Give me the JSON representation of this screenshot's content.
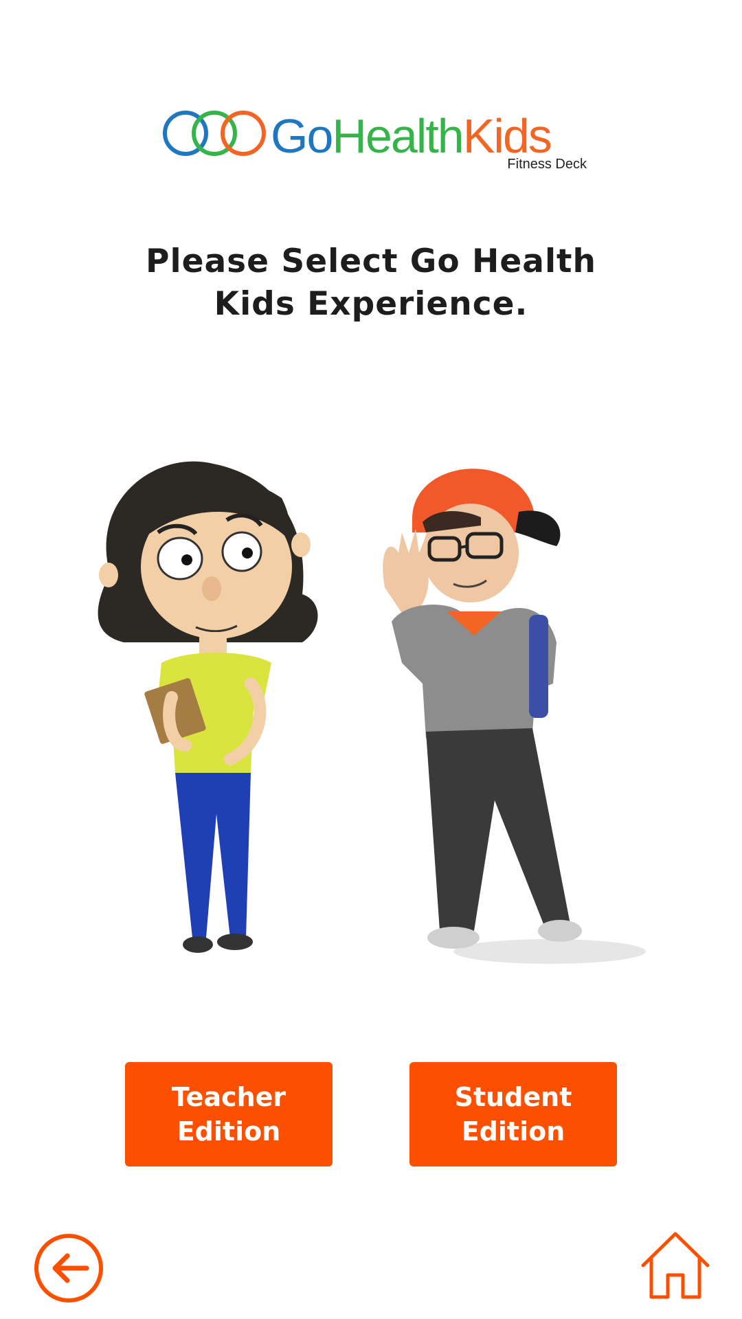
{
  "logo": {
    "word_go": "Go",
    "word_health": "Health",
    "word_kids": "Kids",
    "subtitle": "Fitness Deck",
    "colors": {
      "blue": "#1f77c0",
      "green": "#35b44a",
      "orange": "#f26522"
    },
    "icon": "three-rings-icon"
  },
  "prompt": {
    "heading": "Please Select Go Health Kids Experience."
  },
  "characters": {
    "teacher": {
      "icon": "teacher-character-illustration"
    },
    "student": {
      "icon": "student-character-illustration"
    }
  },
  "buttons": {
    "teacher_edition": "Teacher Edition",
    "student_edition": "Student Edition",
    "color": "#fc5000"
  },
  "nav": {
    "back_icon": "back-arrow-icon",
    "home_icon": "home-icon",
    "color": "#fc5000"
  }
}
